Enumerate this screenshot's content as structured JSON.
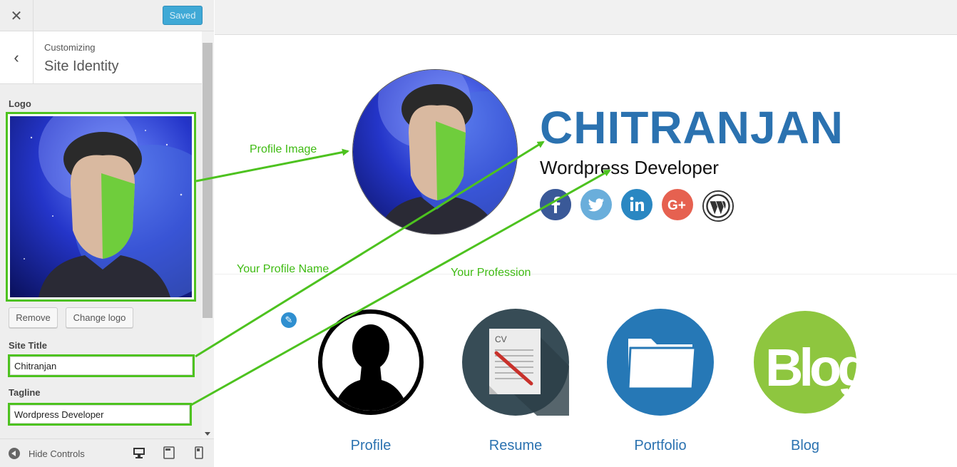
{
  "sidebar": {
    "close_icon": "close-icon",
    "save_label": "Saved",
    "breadcrumb": "Customizing",
    "section_title": "Site Identity",
    "logo_label": "Logo",
    "remove_label": "Remove",
    "change_logo_label": "Change logo",
    "site_title_label": "Site Title",
    "site_title_value": "Chitranjan",
    "tagline_label": "Tagline",
    "tagline_value": "Wordpress Developer",
    "hide_controls_label": "Hide Controls",
    "devices": [
      "desktop-icon",
      "tablet-icon",
      "mobile-icon"
    ]
  },
  "preview": {
    "site_title": "CHITRANJAN",
    "tagline": "Wordpress Developer",
    "social": [
      {
        "name": "facebook",
        "glyph": "f",
        "color": "#3b5998"
      },
      {
        "name": "twitter",
        "glyph": "t",
        "color": "#55acee"
      },
      {
        "name": "linkedin",
        "glyph": "in",
        "color": "#0e76a8"
      },
      {
        "name": "google-plus",
        "glyph": "G+",
        "color": "#dd4b39"
      },
      {
        "name": "wordpress",
        "glyph": "W",
        "color": "#333333"
      }
    ],
    "tiles": [
      {
        "label": "Profile"
      },
      {
        "label": "Resume"
      },
      {
        "label": "Portfolio"
      },
      {
        "label": "Blog"
      }
    ],
    "resume_cv_text": "CV",
    "blog_icon_text": "Blog"
  },
  "annotations": {
    "profile_image": "Profile Image",
    "profile_name": "Your Profile Name",
    "profession": "Your Profession",
    "color": "#4dc21f"
  }
}
